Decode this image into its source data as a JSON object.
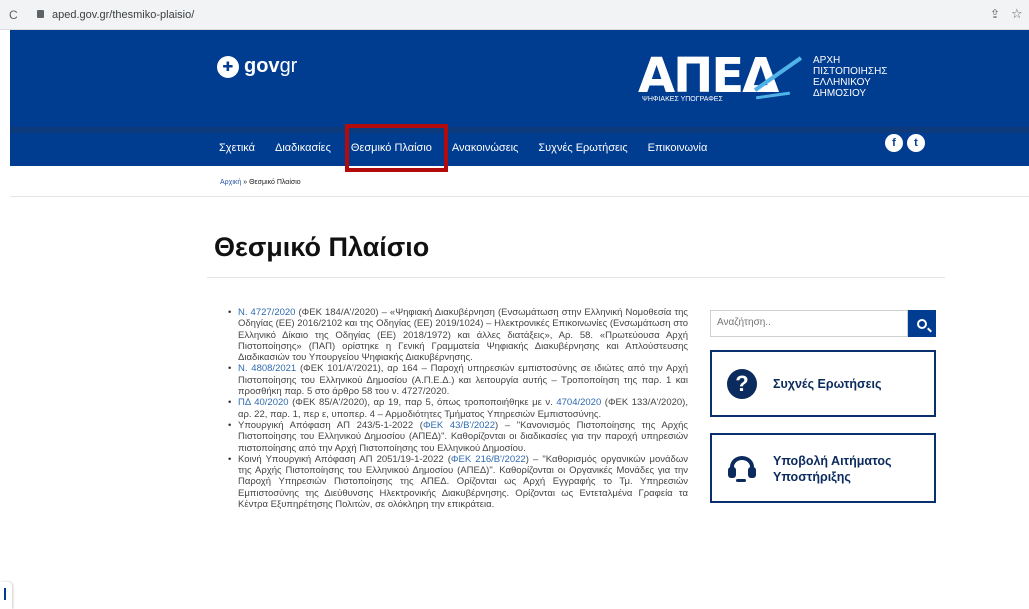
{
  "browser": {
    "url": "aped.gov.gr/thesmiko-plaisio/"
  },
  "header": {
    "govgr_gov": "gov",
    "govgr_gr": "gr",
    "aped_logo": "ΑΠΕΔ",
    "aped_sub": "ΨΗΦΙΑΚΕΣ ΥΠΟΓΡΑΦΕΣ",
    "authority_lines": [
      "ΑΡΧΗ",
      "ΠΙΣΤΟΠΟΙΗΣΗΣ",
      "ΕΛΛΗΝΙΚΟΥ",
      "ΔΗΜΟΣΙΟΥ"
    ]
  },
  "nav": {
    "items": [
      "Σχετικά",
      "Διαδικασίες",
      "Θεσμικό Πλαίσιο",
      "Ανακοινώσεις",
      "Συχνές Ερωτήσεις",
      "Επικοινωνία"
    ],
    "social": [
      "f",
      "t"
    ]
  },
  "breadcrumb": {
    "home": "Αρχική",
    "separator": "»",
    "current": "Θεσμικό Πλαίσιο"
  },
  "page": {
    "title": "Θεσμικό Πλαίσιο"
  },
  "content": {
    "items": [
      {
        "ref": "Ν. 4727/2020",
        "text": " (ΦΕΚ 184/Α'/2020) – «Ψηφιακή Διακυβέρνηση (Ενσωμάτωση στην Ελληνική Νομοθεσία της Οδηγίας (ΕΕ) 2016/2102 και της Οδηγίας (ΕΕ) 2019/1024) – Ηλεκτρονικές Επικοινωνίες (Ενσωμάτωση στο Ελληνικό Δίκαιο της Οδηγίας (ΕΕ) 2018/1972) και άλλες διατάξεις», Αρ. 58. «Πρωτεύουσα Αρχή Πιστοποίησης» (ΠΑΠ) ορίστηκε η Γενική Γραμματεία Ψηφιακής Διακυβέρνησης και Απλούστευσης Διαδικασιών του Υπουργείου Ψηφιακής Διακυβέρνησης."
      },
      {
        "ref": "Ν. 4808/2021",
        "text": " (ΦΕΚ 101/Α'/2021), αρ 164 – Παροχή υπηρεσιών εμπιστοσύνης σε ιδιώτες από την Αρχή Πιστοποίησης του Ελληνικού Δημοσίου (Α.Π.Ε.Δ.) και λειτουργία αυτής – Τροποποίηση της παρ. 1 και προσθήκη παρ. 5 στο άρθρο 58 του ν. 4727/2020."
      },
      {
        "ref": "ΠΔ 40/2020",
        "text": " (ΦΕΚ 85/Α'/2020), αρ 19, παρ 5, όπως τροποποιήθηκε με ν. ",
        "ref2": "4704/2020",
        "text2": " (ΦΕΚ 133/Α'/2020), αρ. 22, παρ. 1, περ ε, υποπερ. 4 – Αρμοδιότητες Τμήματος Υπηρεσιών Εμπιστοσύνης."
      },
      {
        "pre": "Υπουργική Απόφαση ΑΠ 243/5-1-2022 (",
        "ref": "ΦΕΚ 43/Β'/2022",
        "text": ") – \"Κανονισμός Πιστοποίησης της Αρχής Πιστοποίησης του Ελληνικού Δημοσίου (ΑΠΕΔ)\". Καθορίζονται οι διαδικασίες για την παροχή υπηρεσιών πιστοποίησης από την Αρχή Πιστοποίησης του Ελληνικού Δημοσίου."
      },
      {
        "pre": "Κοινή Υπουργική Απόφαση ΑΠ 2051/19-1-2022 (",
        "ref": "ΦΕΚ 216/Β'/2022",
        "text": ") – \"Καθορισμός οργανικών μονάδων της Αρχής Πιστοποίησης του Ελληνικού Δημοσίου (ΑΠΕΔ)\". Καθορίζονται οι Οργανικές Μονάδες για την Παροχή Υπηρεσιών Πιστοποίησης της ΑΠΕΔ. Ορίζονται ως Αρχή Εγγραφής το Τμ. Υπηρεσιών Εμπιστοσύνης της Διεύθυνσης Ηλεκτρονικής Διακυβέρνησης. Ορίζονται ως Εντεταλμένα Γραφεία τα Κέντρα Εξυπηρέτησης Πολιτών, σε ολόκληρη την επικράτεια."
      }
    ]
  },
  "sidebar": {
    "search_placeholder": "Αναζήτηση..",
    "faq_label": "Συχνές Ερωτήσεις",
    "support_label": "Υποβολή Αιτήματος Υποστήριξης"
  }
}
